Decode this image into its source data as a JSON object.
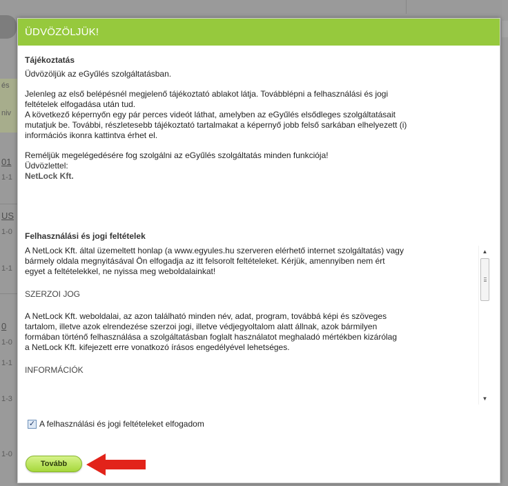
{
  "background": {
    "fragments": [
      "és",
      "niv",
      "01",
      "1-1",
      "US",
      "1-0",
      "1-1",
      "0",
      "1-0",
      "1-1",
      "1-3",
      "1-0"
    ]
  },
  "modal": {
    "title": "ÜDVÖZÖLJÜK!",
    "info": {
      "title": "Tájékoztatás",
      "greeting": "Üdvözöljük az eGyűlés szolgáltatásban.",
      "lines": [
        "Jelenleg az első belépésnél megjelenő tájékoztató ablakot látja. Továbblépni a felhasználási és jogi",
        "feltételek elfogadása után tud.",
        "A következő képernyőn egy pár perces videót láthat, amelyben az eGyűlés elsődleges szolgáltatásait",
        "mutatjuk be. További, részletesebb tájékoztató tartalmakat a képernyő jobb felső sarkában elhelyezett (i)",
        "információs ikonra kattintva érhet el."
      ],
      "closing": "Reméljük megelégedésére fog szolgálni az eGyűlés szolgáltatás minden funkciója!",
      "regards": "Üdvözlettel:",
      "signature": "NetLock Kft."
    },
    "terms": {
      "title": "Felhasználási és jogi feltételek",
      "intro": [
        "A NetLock Kft. által üzemeltett honlap (a www.egyules.hu szerveren elérhető internet szolgáltatás) vagy",
        "bármely oldala megnyitásával Ön elfogadja az itt felsorolt feltételeket. Kérjük, amennyiben nem ért",
        "egyet a feltételekkel, ne nyissa meg weboldalainkat!"
      ],
      "copyright_heading": "SZERZOI JOG",
      "copyright_text": [
        "A NetLock Kft. weboldalai, az azon található minden név, adat, program, továbbá képi és szöveges",
        "tartalom, illetve azok elrendezése szerzoi jogi, illetve védjegyoltalom alatt állnak, azok bármilyen",
        "formában történő felhasználása a szolgáltatásban foglalt használatot meghaladó mértékben kizárólag",
        "a NetLock Kft. kifejezett erre vonatkozó írásos engedélyével lehetséges."
      ],
      "info_heading": "INFORMÁCIÓK"
    },
    "accept": {
      "checked": true,
      "label": "A felhasználási és jogi feltételeket elfogadom"
    },
    "next_button": "Tovább"
  },
  "colors": {
    "header": "#96c93d",
    "button": "#a6d83c",
    "arrow": "#e2231a"
  },
  "icons": [
    "check-icon",
    "scroll-up-icon",
    "scroll-down-icon",
    "red-arrow-icon"
  ]
}
